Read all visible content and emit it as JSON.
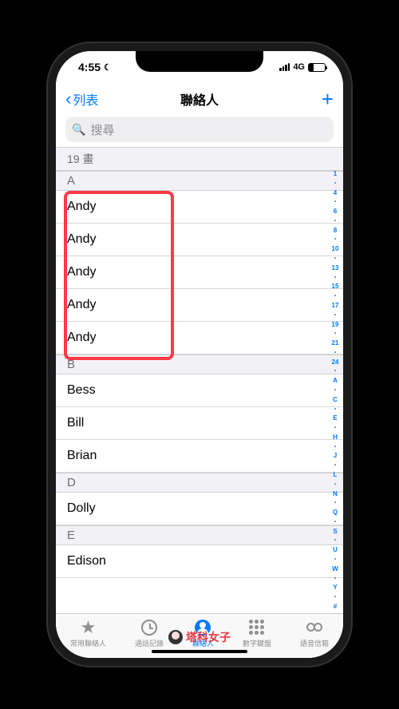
{
  "status": {
    "time": "4:55",
    "network": "4G"
  },
  "nav": {
    "back": "列表",
    "title": "聯絡人"
  },
  "search": {
    "placeholder": "搜尋"
  },
  "sections": [
    {
      "header": "19 畫",
      "type": "stroke",
      "rows": []
    },
    {
      "header": "A",
      "type": "letter",
      "rows": [
        "Andy",
        "Andy",
        "Andy",
        "Andy",
        "Andy"
      ]
    },
    {
      "header": "B",
      "type": "letter",
      "rows": [
        "Bess",
        "Bill",
        "Brian"
      ]
    },
    {
      "header": "D",
      "type": "letter",
      "rows": [
        "Dolly"
      ]
    },
    {
      "header": "E",
      "type": "letter",
      "rows": [
        "Edison"
      ]
    }
  ],
  "index": [
    "1",
    "•",
    "4",
    "•",
    "6",
    "•",
    "8",
    "•",
    "10",
    "•",
    "13",
    "•",
    "15",
    "•",
    "17",
    "•",
    "19",
    "•",
    "21",
    "•",
    "24",
    "•",
    "A",
    "•",
    "C",
    "•",
    "E",
    "•",
    "H",
    "•",
    "J",
    "•",
    "L",
    "•",
    "N",
    "•",
    "Q",
    "•",
    "S",
    "•",
    "U",
    "•",
    "W",
    "•",
    "Y",
    "•",
    "#"
  ],
  "tabs": [
    {
      "label": "常用聯絡人",
      "icon": "star",
      "active": false
    },
    {
      "label": "通話記錄",
      "icon": "clock",
      "active": false
    },
    {
      "label": "聯絡人",
      "icon": "person",
      "active": true
    },
    {
      "label": "數字鍵盤",
      "icon": "keypad",
      "active": false
    },
    {
      "label": "語音信箱",
      "icon": "voicemail",
      "active": false
    }
  ],
  "watermark": "塔科女子"
}
